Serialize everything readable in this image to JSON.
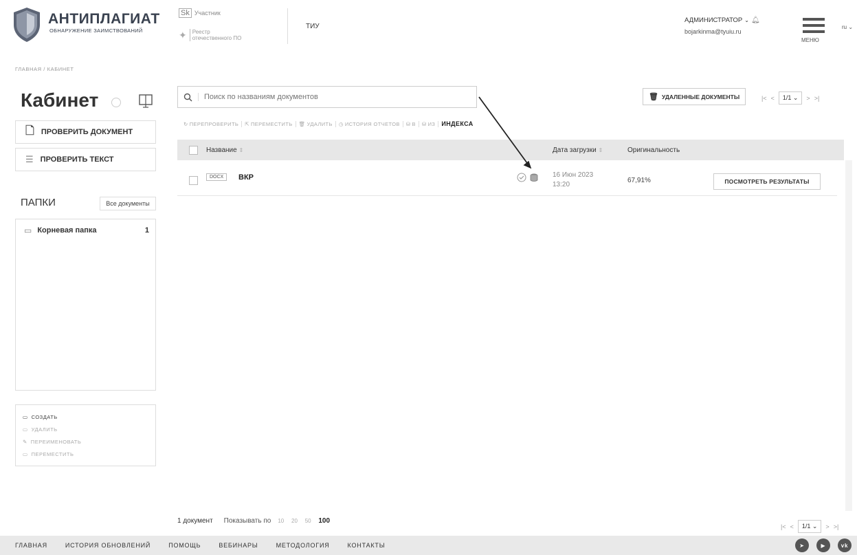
{
  "header": {
    "logo_title": "АНТИПЛАГИАТ",
    "logo_subtitle": "ОБНАРУЖЕНИЕ ЗАИМСТВОВАНИЙ",
    "skolkovo_logo": "Sk",
    "skolkovo_text": "Участник",
    "registry_text_1": "Реестр",
    "registry_text_2": "отечественного ПО",
    "organization": "ТИУ",
    "user_role": "АДМИНИСТРАТОР",
    "user_email": "bojarkinma@tyuiu.ru",
    "menu_label": "МЕНЮ",
    "language": "ru"
  },
  "breadcrumb": "ГЛАВНАЯ / КАБИНЕТ",
  "sidebar": {
    "title": "Кабинет",
    "check_document": "ПРОВЕРИТЬ ДОКУМЕНТ",
    "check_text": "ПРОВЕРИТЬ ТЕКСТ",
    "folders_title": "ПАПКИ",
    "all_documents": "Все документы",
    "folders": [
      {
        "name": "Корневая папка",
        "count": "1"
      }
    ],
    "folder_actions": {
      "create": "СОЗДАТЬ",
      "delete": "УДАЛИТЬ",
      "rename": "ПЕРЕИМЕНОВАТЬ",
      "move": "ПЕРЕМЕСТИТЬ"
    }
  },
  "main": {
    "search_placeholder": "Поиск по названиям документов",
    "deleted_documents": "УДАЛЕННЫЕ ДОКУМЕНТЫ",
    "page_indicator": "1/1",
    "toolbar": {
      "recheck": "ПЕРЕПРОВЕРИТЬ",
      "move": "ПЕРЕМЕСТИТЬ",
      "delete": "УДАЛИТЬ",
      "report_history": "ИСТОРИЯ ОТЧЕТОВ",
      "to": "В",
      "from": "ИЗ",
      "index": "ИНДЕКСА"
    },
    "table": {
      "col_name": "Название",
      "col_date": "Дата загрузки",
      "col_originality": "Оригинальность",
      "rows": [
        {
          "type": "DOCX",
          "name": "ВКР",
          "date": "16 Июн 2023",
          "time": "13:20",
          "originality": "67,91%",
          "action": "ПОСМОТРЕТЬ РЕЗУЛЬТАТЫ"
        }
      ]
    },
    "doc_count": "1 документ",
    "show_by": "Показывать по",
    "page_sizes": [
      "10",
      "20",
      "50",
      "100"
    ],
    "active_page_size": "100"
  },
  "footer": {
    "links": [
      "ГЛАВНАЯ",
      "ИСТОРИЯ ОБНОВЛЕНИЙ",
      "ПОМОЩЬ",
      "ВЕБИНАРЫ",
      "МЕТОДОЛОГИЯ",
      "КОНТАКТЫ"
    ]
  },
  "colors": {
    "accent": "#3a4250",
    "table_header": "#e7e7e7",
    "footer_bg": "#e9e9e9"
  }
}
